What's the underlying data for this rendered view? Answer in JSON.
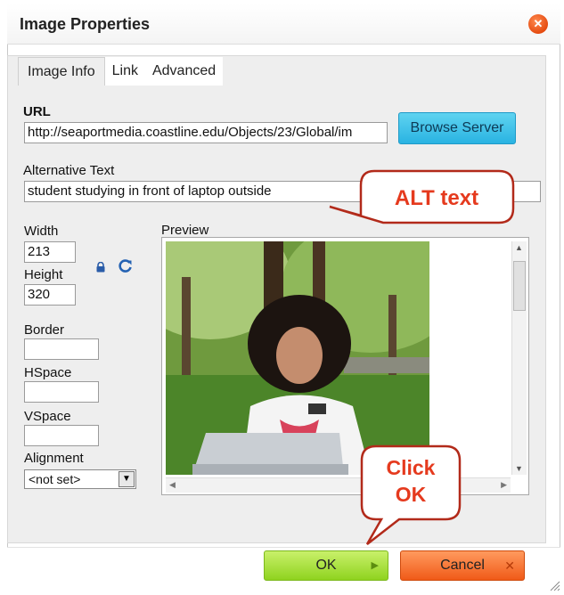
{
  "dialog": {
    "title": "Image Properties",
    "close_icon": "close-icon"
  },
  "tabs": [
    {
      "label": "Image Info",
      "active": true
    },
    {
      "label": "Link",
      "active": false
    },
    {
      "label": "Advanced",
      "active": false
    }
  ],
  "url": {
    "label": "URL",
    "value": "http://seaportmedia.coastline.edu/Objects/23/Global/im"
  },
  "browse_server": {
    "label": "Browse Server"
  },
  "alt_text": {
    "label": "Alternative Text",
    "value": "student studying in front of laptop outside"
  },
  "width": {
    "label": "Width",
    "value": "213"
  },
  "height": {
    "label": "Height",
    "value": "320"
  },
  "border": {
    "label": "Border",
    "value": ""
  },
  "hspace": {
    "label": "HSpace",
    "value": ""
  },
  "vspace": {
    "label": "VSpace",
    "value": ""
  },
  "alignment": {
    "label": "Alignment",
    "selected": "<not set>"
  },
  "preview": {
    "label": "Preview"
  },
  "buttons": {
    "ok": "OK",
    "cancel": "Cancel"
  },
  "callouts": {
    "alt": "ALT text",
    "ok_line1": "Click",
    "ok_line2": "OK"
  },
  "colors": {
    "ok_button": "#8fd31f",
    "cancel_button": "#f05a18",
    "browse_button": "#29b3e2",
    "callout_text": "#e53a1e",
    "callout_border": "#b22a1a"
  }
}
